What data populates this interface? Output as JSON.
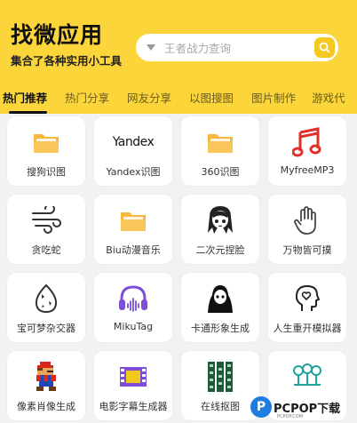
{
  "header": {
    "title": "找微应用",
    "subtitle": "集合了各种实用小工具",
    "search_placeholder": "王者战力查询"
  },
  "tabs": [
    {
      "label": "热门推荐",
      "active": true
    },
    {
      "label": "热门分享",
      "active": false
    },
    {
      "label": "网友分享",
      "active": false
    },
    {
      "label": "以图搜图",
      "active": false
    },
    {
      "label": "图片制作",
      "active": false
    },
    {
      "label": "游戏代",
      "active": false
    }
  ],
  "tools": [
    {
      "label": "搜狗识图",
      "icon": "folder-icon"
    },
    {
      "label": "Yandex识图",
      "icon": "yandex-logo"
    },
    {
      "label": "360识图",
      "icon": "folder-icon"
    },
    {
      "label": "MyfreeMP3",
      "icon": "music-note-icon"
    },
    {
      "label": "贪吃蛇",
      "icon": "wind-icon"
    },
    {
      "label": "Biu动漫音乐",
      "icon": "folder-icon"
    },
    {
      "label": "二次元捏脸",
      "icon": "anime-face-icon"
    },
    {
      "label": "万物皆可摸",
      "icon": "hand-icon"
    },
    {
      "label": "宝可梦杂交器",
      "icon": "egg-icon"
    },
    {
      "label": "MikuTag",
      "icon": "headphones-icon"
    },
    {
      "label": "卡通形象生成",
      "icon": "ghost-icon"
    },
    {
      "label": "人生重开模拟器",
      "icon": "head-heart-icon"
    },
    {
      "label": "像素肖像生成",
      "icon": "pixel-mario-icon"
    },
    {
      "label": "电影字幕生成器",
      "icon": "film-icon"
    },
    {
      "label": "在线抠图",
      "icon": "film-strip-icon"
    },
    {
      "label": "",
      "icon": "tree-icon"
    }
  ],
  "yandex_logo_text": "Yandex",
  "watermark": {
    "logo": "P",
    "text": "PCPOP下载",
    "sub": "PCPOP.COM"
  },
  "colors": {
    "header": "#fbd53a",
    "search_button": "#f4c81e",
    "accent_red": "#e0302a",
    "accent_purple": "#7b4fd6",
    "accent_teal": "#1ea39a"
  }
}
